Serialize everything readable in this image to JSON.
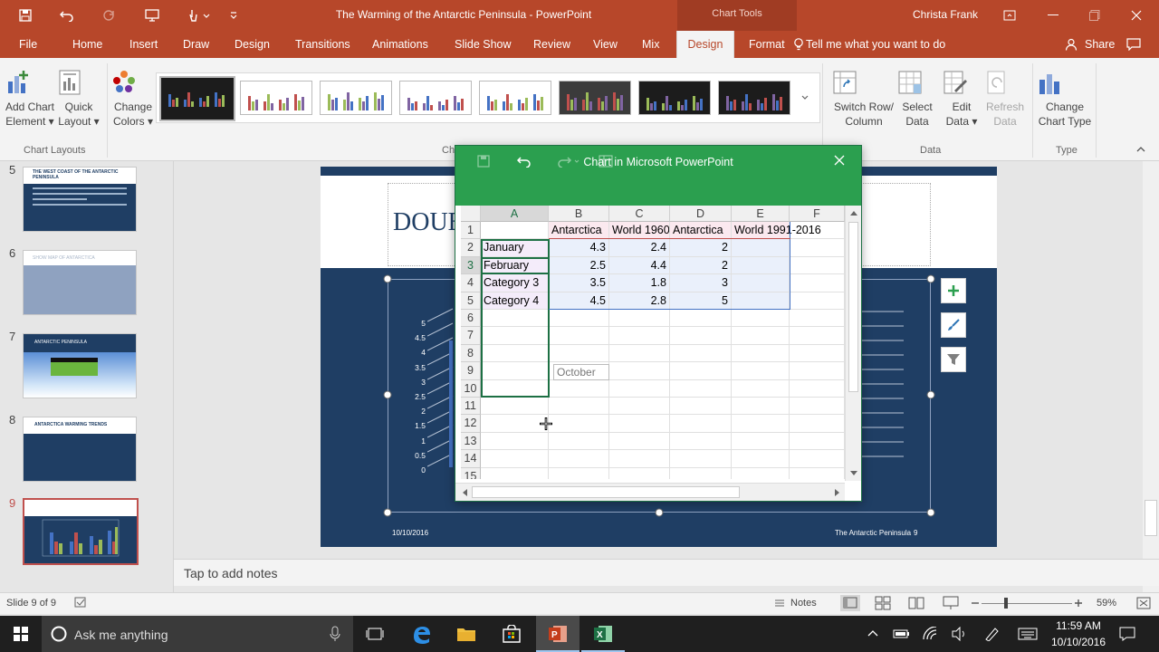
{
  "window": {
    "title": "The Warming of the Antarctic Peninsula - PowerPoint",
    "contextual_group": "Chart Tools",
    "user": "Christa Frank"
  },
  "tabs": [
    "File",
    "Home",
    "Insert",
    "Draw",
    "Design",
    "Transitions",
    "Animations",
    "Slide Show",
    "Review",
    "View",
    "Mix"
  ],
  "context_tabs": {
    "design": "Design",
    "format": "Format"
  },
  "tell_me": "Tell me what you want to do",
  "share": "Share",
  "ribbon": {
    "add_chart_element": [
      "Add Chart",
      "Element ▾"
    ],
    "quick_layout": [
      "Quick",
      "Layout ▾"
    ],
    "change_colors": [
      "Change",
      "Colors ▾"
    ],
    "switch_row_column": [
      "Switch Row/",
      "Column"
    ],
    "select_data": [
      "Select",
      "Data"
    ],
    "edit_data": [
      "Edit",
      "Data ▾"
    ],
    "refresh_data": [
      "Refresh",
      "Data"
    ],
    "change_chart_type": [
      "Change",
      "Chart Type"
    ],
    "group_chart_layouts": "Chart Layouts",
    "group_chart_styles_partial": "Ch",
    "group_data": "Data",
    "group_type": "Type"
  },
  "slides": [
    {
      "num": "5",
      "title": "THE WEST COAST OF THE ANTARCTIC PENINSULA"
    },
    {
      "num": "6",
      "title": "SHOW MAP OF ANTARCTICA"
    },
    {
      "num": "7",
      "title": "ANTARCTIC PENINSULA"
    },
    {
      "num": "8",
      "title": "ANTARCTICA WARMING TRENDS"
    },
    {
      "num": "9",
      "title": ""
    }
  ],
  "slide": {
    "title_partial": "DOUB",
    "date": "10/10/2016",
    "footer": "The Antarctic Peninsula",
    "page": "9",
    "axis_ticks": [
      "5",
      "4.5",
      "4",
      "3.5",
      "3",
      "2.5",
      "2",
      "1.5",
      "1",
      "0.5",
      "0"
    ]
  },
  "notes_placeholder": "Tap to add notes",
  "status": {
    "slide_info": "Slide 9 of 9",
    "notes": "Notes",
    "zoom": "59%"
  },
  "excel": {
    "title": "Chart in Microsoft PowerPoint",
    "columns": [
      "A",
      "B",
      "C",
      "D",
      "E",
      "F"
    ],
    "rows": [
      "1",
      "2",
      "3",
      "4",
      "5",
      "6",
      "7",
      "8",
      "9",
      "10",
      "11",
      "12",
      "13",
      "14",
      "15"
    ],
    "header_row": [
      "",
      "Antarctica",
      "World 1960",
      "Antarctica",
      "World 1991-2016",
      ""
    ],
    "data_rows": [
      [
        "January",
        "4.3",
        "2.4",
        "2",
        ""
      ],
      [
        "February",
        "2.5",
        "4.4",
        "2",
        ""
      ],
      [
        "Category 3",
        "3.5",
        "1.8",
        "3",
        ""
      ],
      [
        "Category 4",
        "4.5",
        "2.8",
        "5",
        ""
      ]
    ],
    "autocomplete": "October"
  },
  "taskbar": {
    "search": "Ask me anything",
    "time": "11:59 AM",
    "date": "10/10/2016"
  },
  "colors": {
    "ppt_red": "#b7472a",
    "excel_green": "#2b9f4f",
    "slide_blue": "#1f3e64"
  }
}
